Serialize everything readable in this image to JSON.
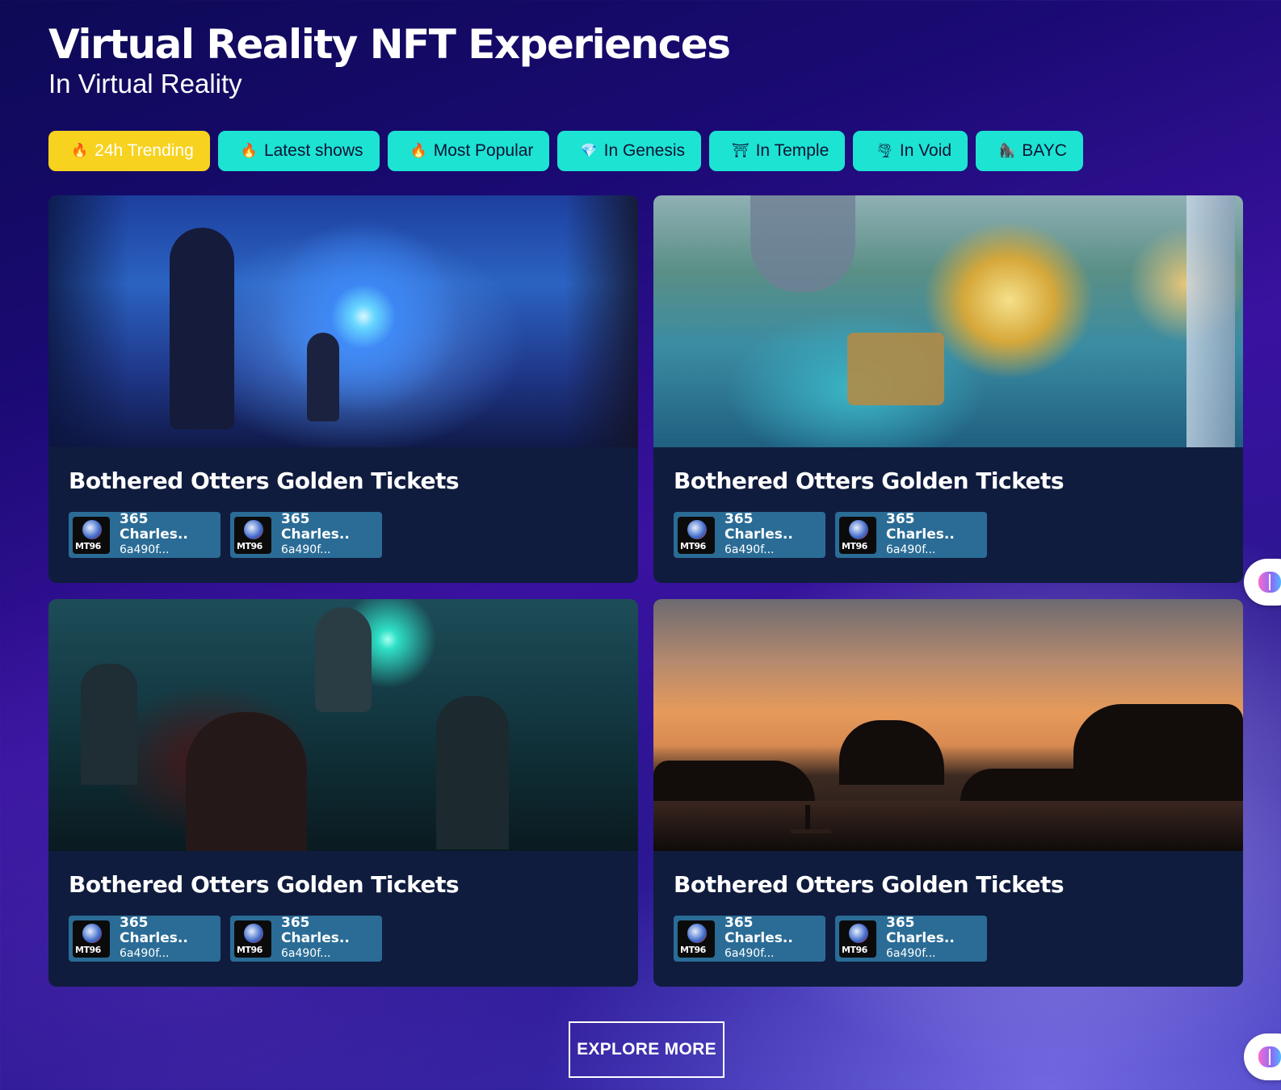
{
  "header": {
    "title": "Virtual Reality NFT Experiences",
    "subtitle": "In Virtual Reality"
  },
  "filters": [
    {
      "icon": "fire-icon",
      "glyph": "🔥",
      "label": "24h Trending",
      "active": true
    },
    {
      "icon": "fire-icon",
      "glyph": "🔥",
      "label": "Latest shows",
      "active": false
    },
    {
      "icon": "fire-icon",
      "glyph": "🔥",
      "label": "Most Popular",
      "active": false
    },
    {
      "icon": "gem-icon",
      "glyph": "💎",
      "label": "In Genesis",
      "active": false
    },
    {
      "icon": "temple-icon",
      "glyph": "⛩",
      "label": "In Temple",
      "active": false
    },
    {
      "icon": "tornado-icon",
      "glyph": "🌪",
      "label": "In Void",
      "active": false
    },
    {
      "icon": "ape-icon",
      "glyph": "🦍",
      "label": "BAYC",
      "active": false
    }
  ],
  "cards": [
    {
      "title": "Bothered Otters Golden Tickets",
      "artwork": "vr-fantasy-portal-artwork",
      "creators": [
        {
          "name": "365 Charles..",
          "address": "6a490f...",
          "avatar_text": "MT96"
        },
        {
          "name": "365 Charles..",
          "address": "6a490f...",
          "avatar_text": "MT96"
        }
      ]
    },
    {
      "title": "Bothered Otters Golden Tickets",
      "artwork": "futuristic-city-artwork",
      "creators": [
        {
          "name": "365 Charles..",
          "address": "6a490f...",
          "avatar_text": "MT96"
        },
        {
          "name": "365 Charles..",
          "address": "6a490f...",
          "avatar_text": "MT96"
        }
      ]
    },
    {
      "title": "Bothered Otters Golden Tickets",
      "artwork": "zombie-wizard-artwork",
      "creators": [
        {
          "name": "365 Charles..",
          "address": "6a490f...",
          "avatar_text": "MT96"
        },
        {
          "name": "365 Charles..",
          "address": "6a490f...",
          "avatar_text": "MT96"
        }
      ]
    },
    {
      "title": "Bothered Otters Golden Tickets",
      "artwork": "sunset-sea-artwork",
      "creators": [
        {
          "name": "365 Charles..",
          "address": "6a490f...",
          "avatar_text": "MT96"
        },
        {
          "name": "365 Charles..",
          "address": "6a490f...",
          "avatar_text": "MT96"
        }
      ]
    }
  ],
  "explore_button": "EXPLORE MORE",
  "colors": {
    "chip_default": "#1de3d2",
    "chip_active": "#f7d21e",
    "card_bg": "#101c3e",
    "creator_chip": "#2a6c96"
  }
}
